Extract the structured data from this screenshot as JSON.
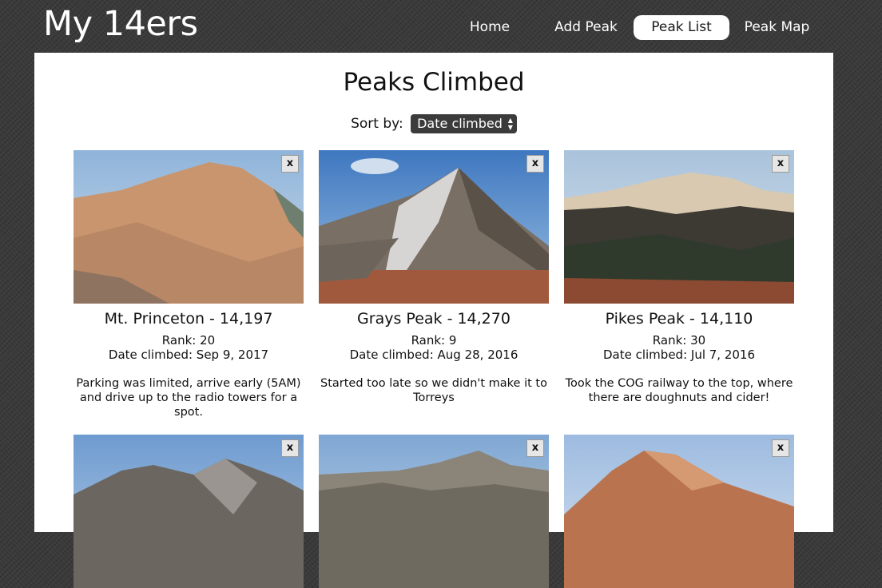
{
  "site": {
    "title": "My 14ers"
  },
  "nav": {
    "items": [
      {
        "label": "Home",
        "active": false
      },
      {
        "label": "Add Peak",
        "active": false
      },
      {
        "label": "Peak List",
        "active": true
      },
      {
        "label": "Peak Map",
        "active": false
      }
    ]
  },
  "page": {
    "title": "Peaks Climbed",
    "sort_label": "Sort by:",
    "sort_value": "Date climbed"
  },
  "cards": [
    {
      "title": "Mt. Princeton - 14,197",
      "rank": "Rank: 20",
      "date": "Date climbed: Sep 9, 2017",
      "notes": "Parking was limited, arrive early (5AM) and drive up to the radio towers for a spot.",
      "remove_label": "x"
    },
    {
      "title": "Grays Peak - 14,270",
      "rank": "Rank: 9",
      "date": "Date climbed: Aug 28, 2016",
      "notes": "Started too late so we didn't make it to Torreys",
      "remove_label": "x"
    },
    {
      "title": "Pikes Peak - 14,110",
      "rank": "Rank: 30",
      "date": "Date climbed: Jul 7, 2016",
      "notes": "Took the COG railway to the top, where there are doughnuts and cider!",
      "remove_label": "x"
    },
    {
      "remove_label": "x"
    },
    {
      "remove_label": "x"
    },
    {
      "remove_label": "x"
    }
  ],
  "colors": {
    "active_nav_bg": "#ffffff",
    "background": "#3a3a3a",
    "panel": "#ffffff",
    "select_bg": "#3b3b3b"
  }
}
